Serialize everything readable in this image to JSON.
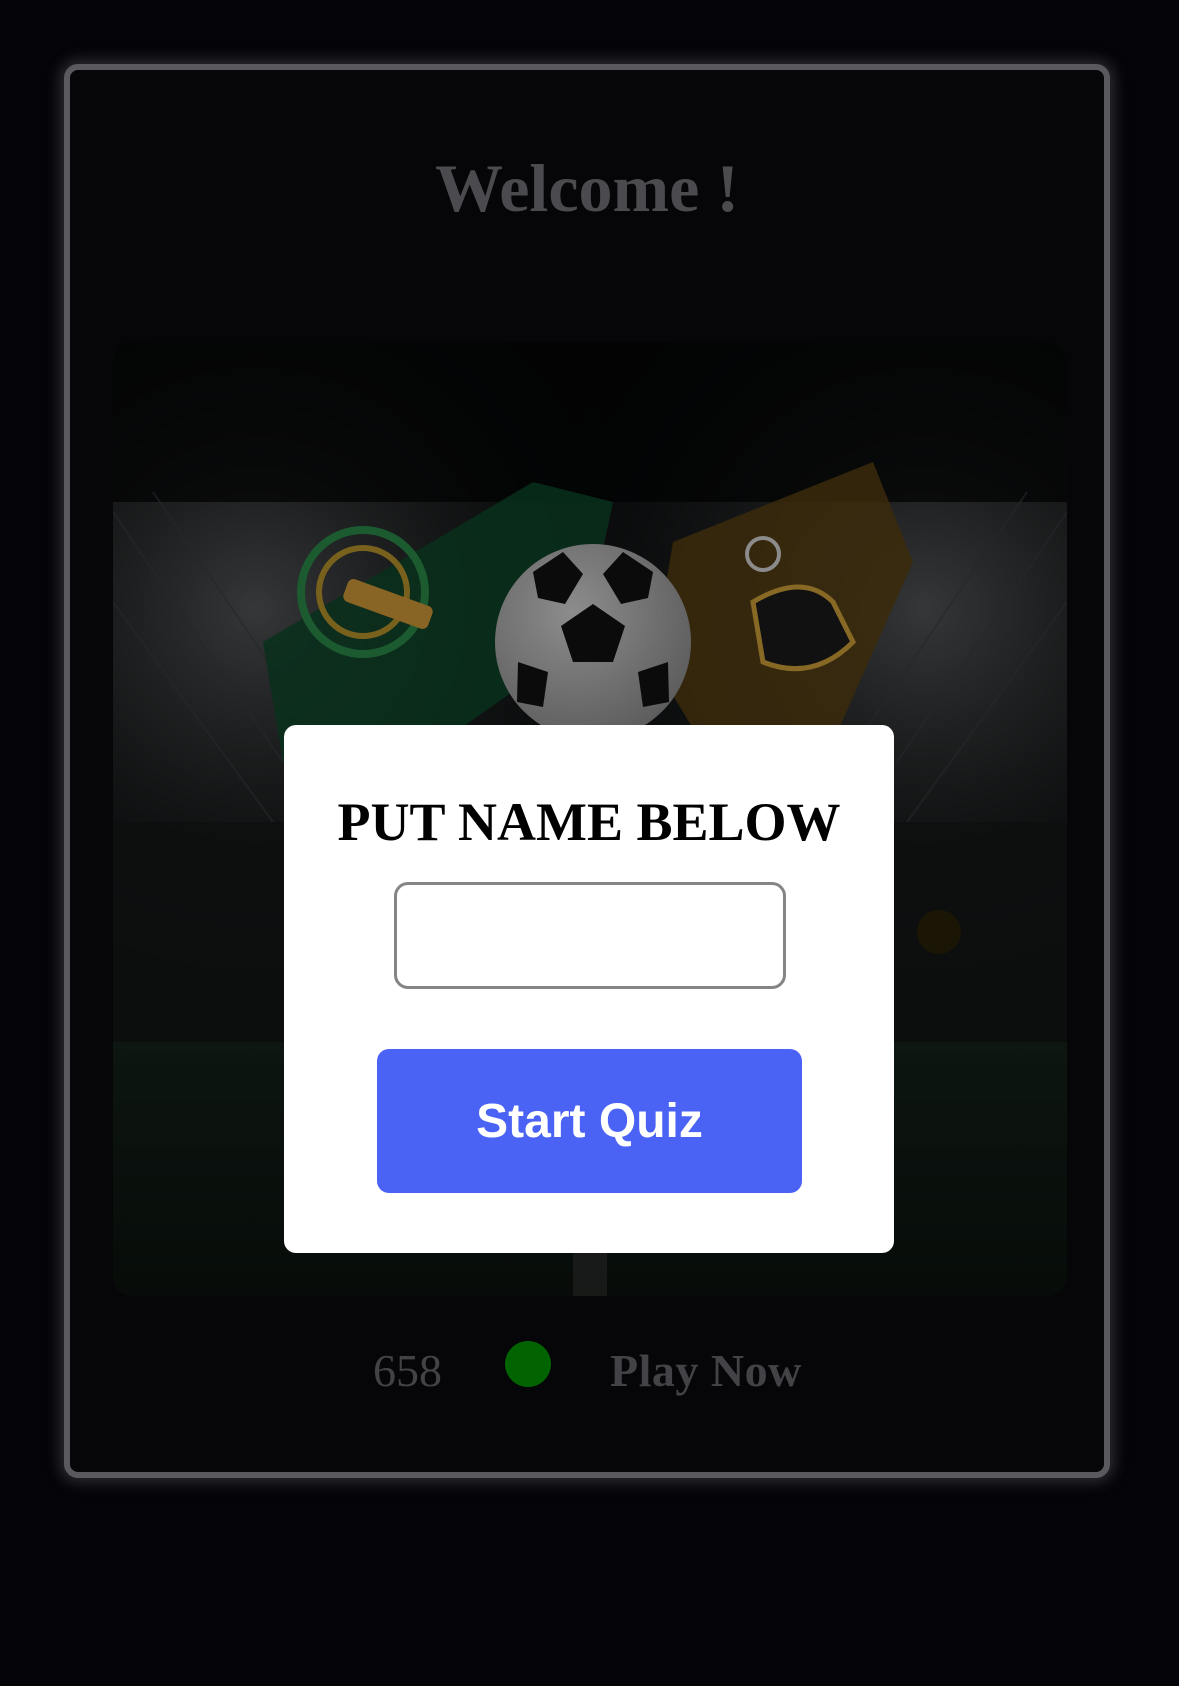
{
  "header": {
    "title": "Welcome !"
  },
  "hero": {
    "image_name": "football-stadium-illustration"
  },
  "footer": {
    "count": "658",
    "status_color": "#016401",
    "play_label": "Play Now"
  },
  "modal": {
    "title": "PUT NAME BELOW",
    "name_input": {
      "value": "",
      "placeholder": ""
    },
    "start_label": "Start Quiz"
  },
  "colors": {
    "accent": "#4a63f5",
    "background": "#050509",
    "card_border": "#5a5a5e"
  }
}
